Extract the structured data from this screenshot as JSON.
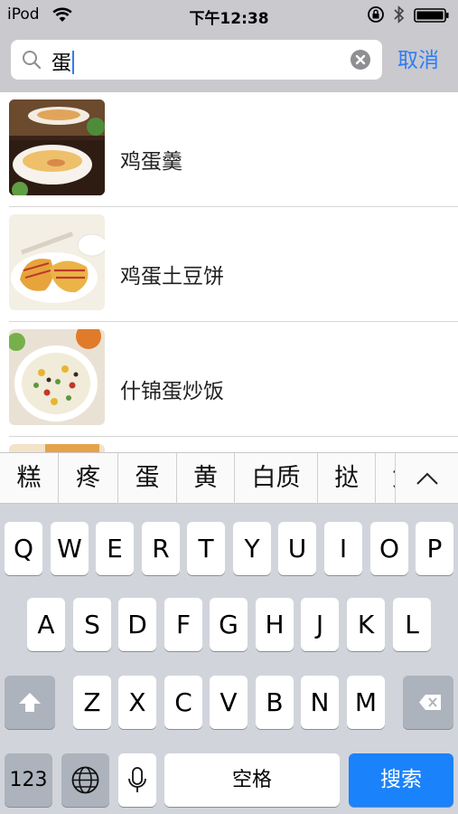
{
  "status_bar": {
    "carrier": "iPod",
    "time": "下午12:38"
  },
  "search": {
    "query": "蛋"
  },
  "cancel_label": "取消",
  "results": [
    {
      "label": "鸡蛋羹"
    },
    {
      "label": "鸡蛋土豆饼"
    },
    {
      "label": "什锦蛋炒饭"
    }
  ],
  "candidates": [
    "糕",
    "疼",
    "蛋",
    "黄",
    "白质",
    "挞",
    "女"
  ],
  "keyboard": {
    "row1": [
      "Q",
      "W",
      "E",
      "R",
      "T",
      "Y",
      "U",
      "I",
      "O",
      "P"
    ],
    "row2": [
      "A",
      "S",
      "D",
      "F",
      "G",
      "H",
      "J",
      "K",
      "L"
    ],
    "row3": [
      "Z",
      "X",
      "C",
      "V",
      "B",
      "N",
      "M"
    ],
    "num_label": "123",
    "space_label": "空格",
    "search_label": "搜索"
  },
  "colors": {
    "accent": "#2f7cf6",
    "search_key": "#1a82fb",
    "keyboard_bg": "#d1d5db",
    "search_area_bg": "#c9c9ce"
  }
}
